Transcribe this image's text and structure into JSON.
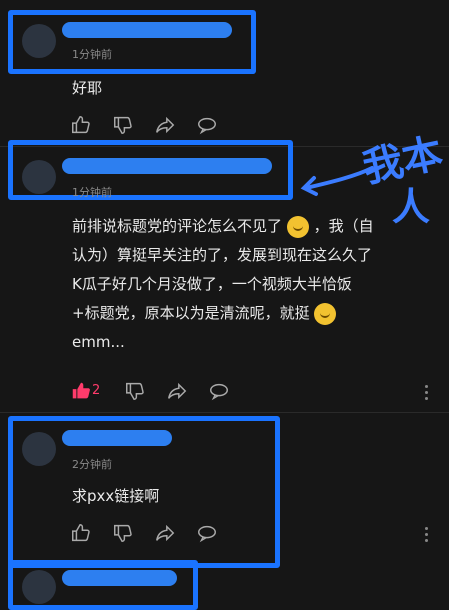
{
  "comments": [
    {
      "time": "1分钟前",
      "text": "好耶",
      "likes": ""
    },
    {
      "time": "1分钟前",
      "lines": [
        "前排说标题党的评论怎么不见了",
        "，我（自",
        "认为）算挺早关注的了，发展到现在这么久了",
        "K瓜子好几个月没做了，一个视频大半恰饭",
        "+标题党，原本以为是清流呢，就挺",
        "emm..."
      ],
      "likes": "2"
    },
    {
      "time": "2分钟前",
      "text": "求pxx链接啊",
      "likes": ""
    }
  ],
  "annotation": {
    "line1": "我本",
    "line2": "人"
  },
  "colors": {
    "highlight": "#1a73ff",
    "like_active": "#ff3b6b"
  }
}
